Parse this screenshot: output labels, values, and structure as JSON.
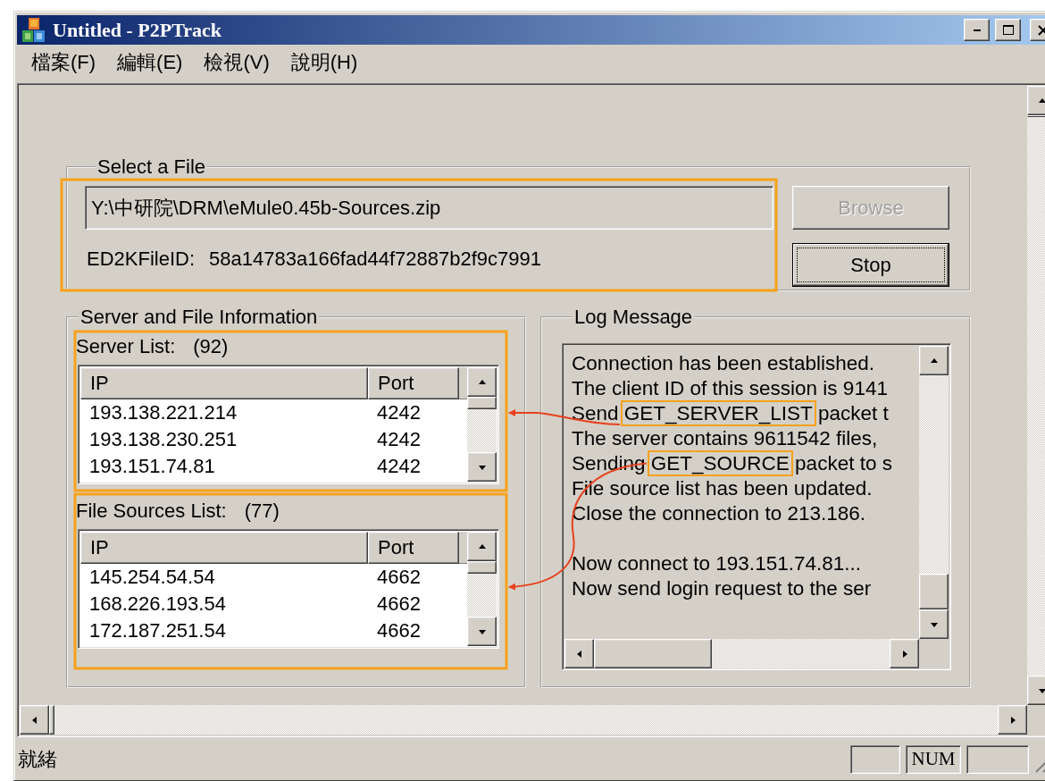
{
  "window": {
    "title": "Untitled - P2PTrack"
  },
  "menu": [
    {
      "label": "檔案(F)"
    },
    {
      "label": "編輯(E)"
    },
    {
      "label": "檢視(V)"
    },
    {
      "label": "說明(H)"
    }
  ],
  "select_file": {
    "legend": "Select a File",
    "path": "Y:\\中研院\\DRM\\eMule0.45b-Sources.zip",
    "file_id_label": "ED2KFileID:",
    "file_id": "58a14783a166fad44f72887b2f9c7991",
    "buttons": [
      {
        "label": "Browse",
        "disabled": true,
        "focused": false
      },
      {
        "label": "Stop",
        "disabled": false,
        "focused": true
      }
    ]
  },
  "info": {
    "legend": "Server and File Information",
    "lists": [
      {
        "label": "Server List:",
        "count": "(92)",
        "columns": [
          "IP",
          "Port"
        ],
        "rows": [
          [
            "193.138.221.214",
            "4242"
          ],
          [
            "193.138.230.251",
            "4242"
          ],
          [
            "193.151.74.81",
            "4242"
          ]
        ]
      },
      {
        "label": "File Sources List:",
        "count": "(77)",
        "columns": [
          "IP",
          "Port"
        ],
        "rows": [
          [
            "145.254.54.54",
            "4662"
          ],
          [
            "168.226.193.54",
            "4662"
          ],
          [
            "172.187.251.54",
            "4662"
          ]
        ]
      }
    ]
  },
  "log": {
    "legend": "Log Message",
    "blocks": [
      {
        "lines": [
          {
            "parts": [
              {
                "text": "Connection has been established.",
                "highlighted": false
              }
            ]
          },
          {
            "parts": [
              {
                "text": "The client ID of this session is 9141",
                "highlighted": false
              }
            ]
          },
          {
            "parts": [
              {
                "text": "Send ",
                "highlighted": false
              },
              {
                "text": "GET_SERVER_LIST",
                "highlighted": true
              },
              {
                "text": " packet t",
                "highlighted": false
              }
            ]
          },
          {
            "parts": [
              {
                "text": "The server contains 9611542 files,",
                "highlighted": false
              }
            ]
          },
          {
            "parts": [
              {
                "text": "Sending ",
                "highlighted": false
              },
              {
                "text": "GET_SOURCE",
                "highlighted": true
              },
              {
                "text": " packet to s",
                "highlighted": false
              }
            ]
          },
          {
            "parts": [
              {
                "text": "File source list has been updated.",
                "highlighted": false
              }
            ]
          },
          {
            "parts": [
              {
                "text": "Close the connection to 213.186.",
                "highlighted": false
              }
            ]
          }
        ]
      },
      {
        "lines": [
          {
            "parts": [
              {
                "text": "Now connect to 193.151.74.81...",
                "highlighted": false
              }
            ]
          },
          {
            "parts": [
              {
                "text": "Now send login request to the ser",
                "highlighted": false
              }
            ]
          }
        ]
      }
    ]
  },
  "status_bar": {
    "text": "就緒",
    "indicators": [
      {
        "kind": "blank"
      },
      {
        "kind": "key",
        "label": "NUM"
      },
      {
        "kind": "blank"
      }
    ]
  }
}
